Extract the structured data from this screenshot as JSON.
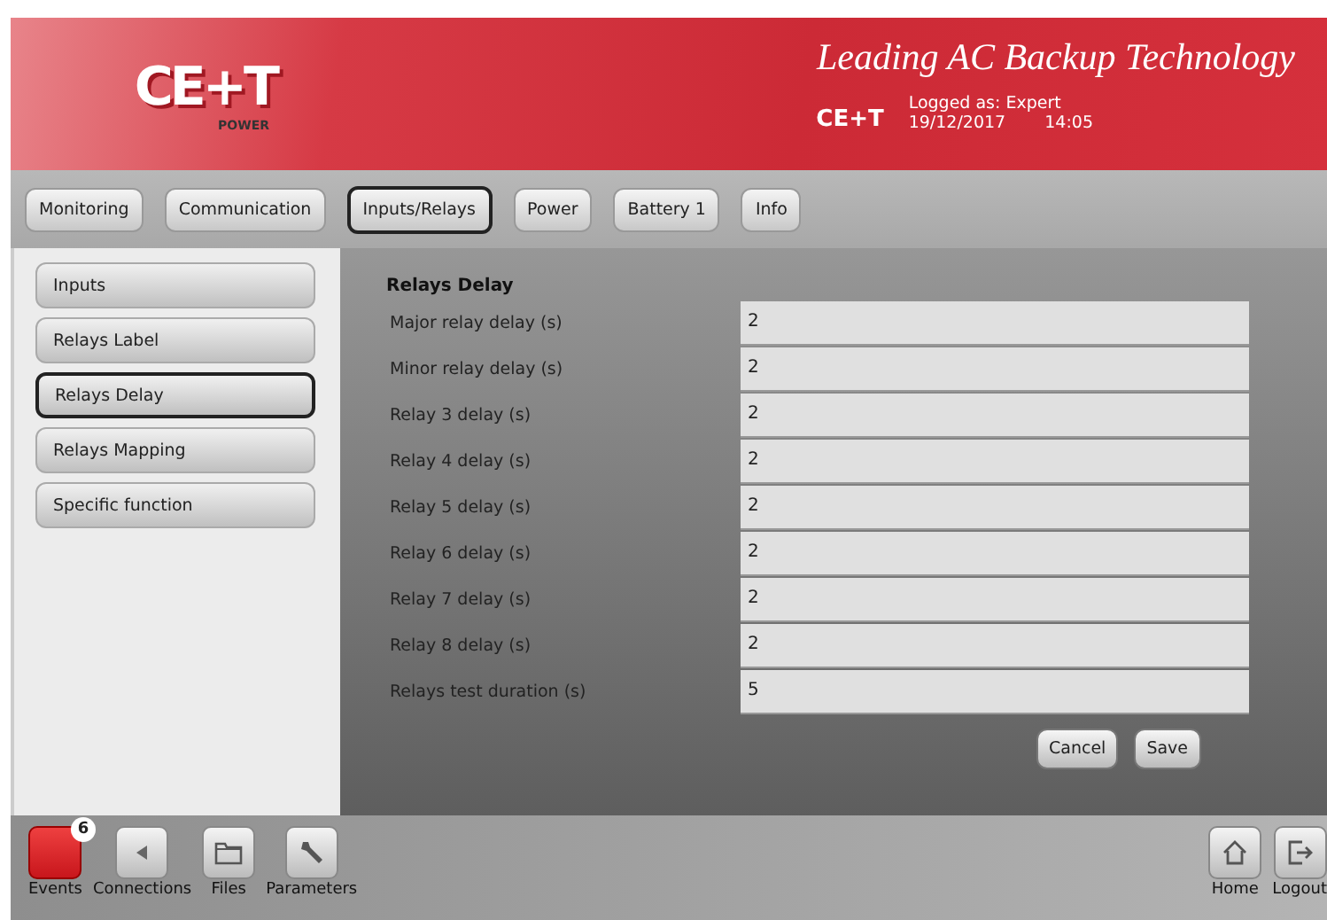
{
  "header": {
    "logo": "CE+T",
    "logo_sub": "POWER",
    "tagline": "Leading AC Backup Technology",
    "site": "CE+T",
    "logged_as": "Logged as: Expert",
    "date": "19/12/2017",
    "time": "14:05"
  },
  "tabs": [
    {
      "label": "Monitoring",
      "selected": false
    },
    {
      "label": "Communication",
      "selected": false
    },
    {
      "label": "Inputs/Relays",
      "selected": true
    },
    {
      "label": "Power",
      "selected": false
    },
    {
      "label": "Battery 1",
      "selected": false
    },
    {
      "label": "Info",
      "selected": false
    }
  ],
  "sidebar": {
    "items": [
      {
        "label": "Inputs",
        "selected": false
      },
      {
        "label": "Relays Label",
        "selected": false
      },
      {
        "label": "Relays Delay",
        "selected": true
      },
      {
        "label": "Relays Mapping",
        "selected": false
      },
      {
        "label": "Specific function",
        "selected": false
      }
    ]
  },
  "form": {
    "title": "Relays Delay",
    "fields": [
      {
        "label": "Major relay delay (s)",
        "value": "2"
      },
      {
        "label": "Minor relay delay (s)",
        "value": "2"
      },
      {
        "label": "Relay 3 delay (s)",
        "value": "2"
      },
      {
        "label": "Relay 4 delay (s)",
        "value": "2"
      },
      {
        "label": "Relay 5 delay (s)",
        "value": "2"
      },
      {
        "label": "Relay 6 delay (s)",
        "value": "2"
      },
      {
        "label": "Relay 7 delay (s)",
        "value": "2"
      },
      {
        "label": "Relay 8 delay (s)",
        "value": "2"
      },
      {
        "label": "Relays test duration (s)",
        "value": "5"
      }
    ],
    "buttons": [
      "Cancel",
      "Save"
    ]
  },
  "bottom_bar": {
    "left": [
      {
        "label": "Events",
        "kind": "events",
        "badge": "6"
      },
      {
        "label": "Connections",
        "kind": "connections"
      },
      {
        "label": "Files",
        "kind": "files"
      },
      {
        "label": "Parameters",
        "kind": "parameters"
      }
    ],
    "right": [
      {
        "label": "Home",
        "kind": "home"
      },
      {
        "label": "Logout",
        "kind": "logout"
      }
    ]
  }
}
